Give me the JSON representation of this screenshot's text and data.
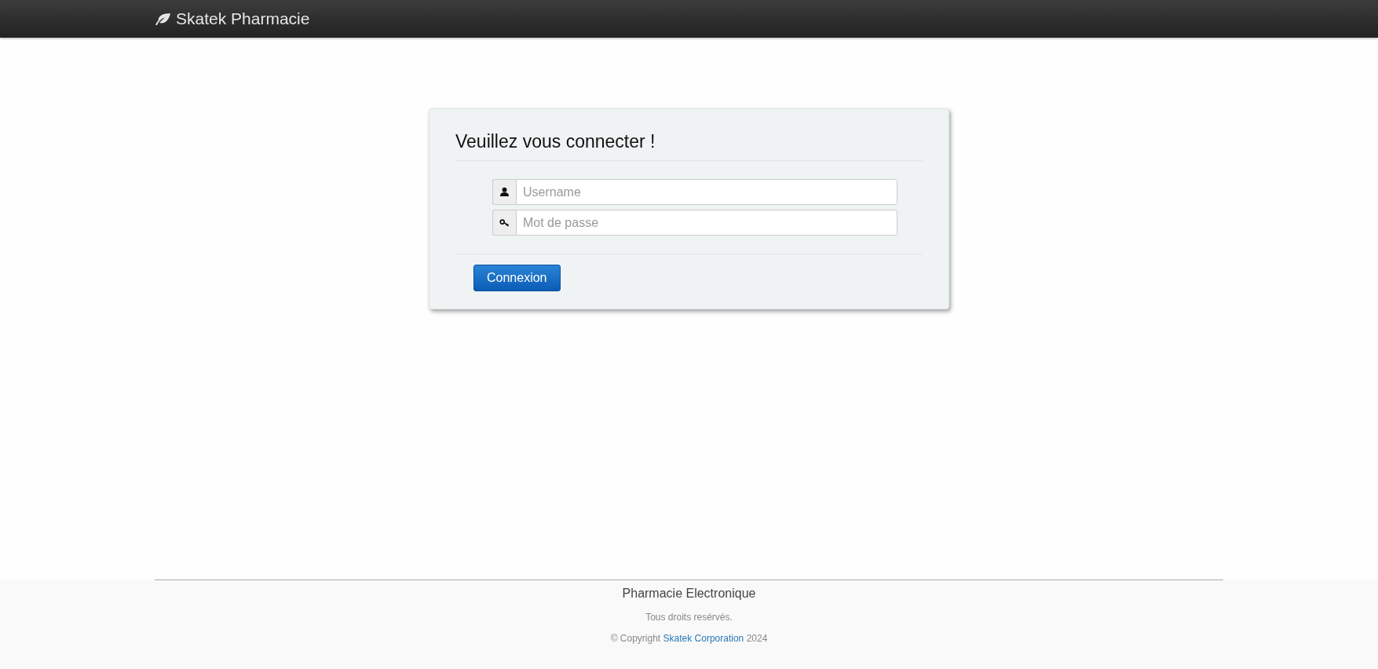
{
  "navbar": {
    "brand": "Skatek Pharmacie"
  },
  "login": {
    "title": "Veuillez vous connecter !",
    "fields": [
      {
        "kind": "user",
        "placeholder": "Username"
      },
      {
        "kind": "password",
        "placeholder": "Mot de passe"
      }
    ],
    "button": "Connexion"
  },
  "footer": {
    "title": "Pharmacie Electronique",
    "rights": "Tous droits resérvés.",
    "copyright_prefix": "© Copyright",
    "copyright_link": "Skatek Corporation",
    "copyright_suffix": "2024"
  }
}
